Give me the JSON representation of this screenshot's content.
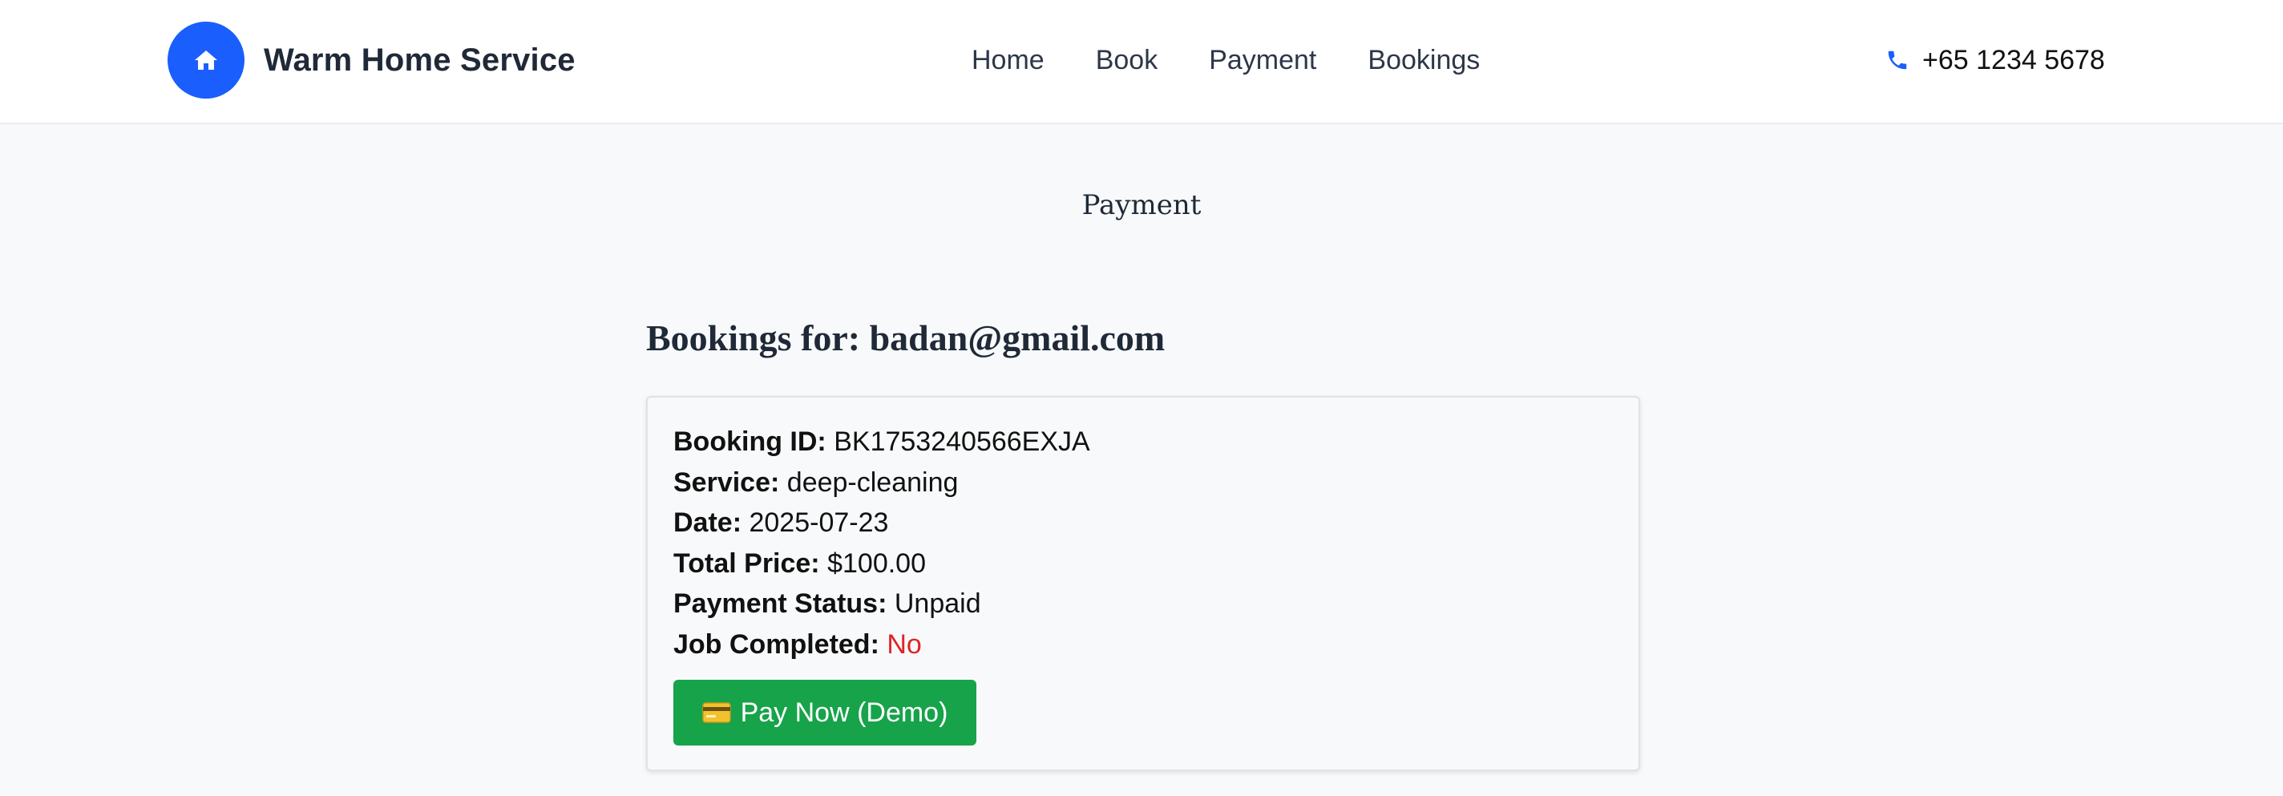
{
  "header": {
    "brand": {
      "name": "Warm Home Service",
      "icon": "home-icon",
      "color": "#1a5ffd"
    },
    "nav": [
      {
        "label": "Home"
      },
      {
        "label": "Book"
      },
      {
        "label": "Payment"
      },
      {
        "label": "Bookings"
      }
    ],
    "phone": {
      "icon": "phone-icon",
      "number": "+65 1234 5678"
    }
  },
  "page": {
    "heading": "Payment",
    "bookings_title": "Bookings for: badan@gmail.com"
  },
  "booking": {
    "fields": [
      {
        "label": "Booking ID:",
        "value": "BK1753240566EXJA"
      },
      {
        "label": "Service:",
        "value": "deep-cleaning"
      },
      {
        "label": "Date:",
        "value": "2025-07-23"
      },
      {
        "label": "Total Price:",
        "value": "$100.00"
      },
      {
        "label": "Payment Status:",
        "value": "Unpaid"
      },
      {
        "label": "Job Completed:",
        "value": "No",
        "color": "#dc2626"
      }
    ],
    "pay_button": {
      "icon": "credit-card-icon",
      "label": "Pay Now (Demo)",
      "color": "#16a34a"
    }
  }
}
